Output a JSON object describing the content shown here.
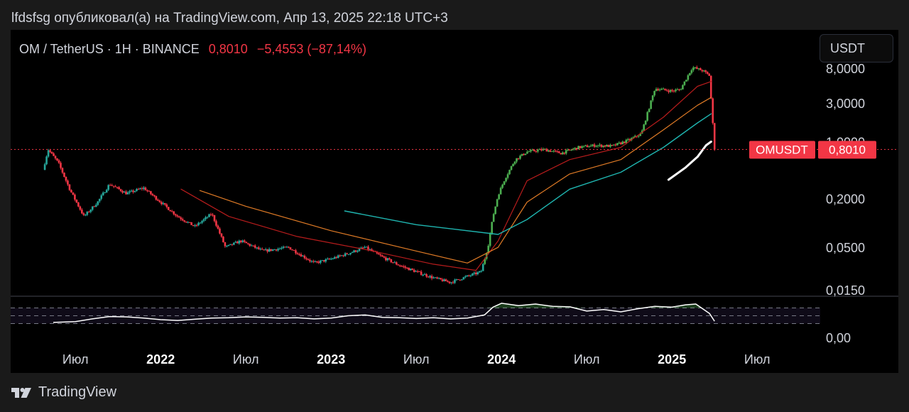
{
  "caption": "lfdsfsg опубликовал(а) на TradingView.com, Апр 13, 2025 22:18 UTC+3",
  "legend": {
    "symbol": "OM / TetherUS · 1H · BINANCE",
    "last": "0,8010",
    "change": "−5,4553 (−87,14%)"
  },
  "currency_button": "USDT",
  "colors": {
    "up": "#26a69a",
    "up_bright": "#4caf50",
    "down": "#f23645",
    "ma_red": "#b71c1c",
    "ma_orange": "#e07b26",
    "ma_cyan": "#1fb5b0",
    "rsi": "#ffffff"
  },
  "chart_data": {
    "type": "line",
    "title": "",
    "price_scale": "log",
    "y_ticks": [
      "8,0000",
      "3,0000",
      "1,0000",
      "0,2000",
      "0,0500",
      "0,0150"
    ],
    "y_tick_values": [
      8,
      3,
      1,
      0.2,
      0.05,
      0.015
    ],
    "ylim": [
      0.0125,
      13
    ],
    "rsi_tick": "0,00",
    "x_ticks": [
      "Июл",
      "2022",
      "Июл",
      "2023",
      "Июл",
      "2024",
      "Июл",
      "2025",
      "Июл"
    ],
    "x_tick_years": [
      2021.5,
      2022.0,
      2022.5,
      2023.0,
      2023.5,
      2024.0,
      2024.5,
      2025.0,
      2025.5
    ],
    "xlim": [
      2021.12,
      2025.87
    ],
    "last_price_label": "OMUSDT",
    "last_price_value": "0,8010",
    "last_price": 0.801,
    "series": [
      {
        "points": [
          [
            2021.31,
            0.45
          ],
          [
            2021.34,
            0.8
          ],
          [
            2021.4,
            0.55
          ],
          [
            2021.47,
            0.25
          ],
          [
            2021.55,
            0.12
          ],
          [
            2021.63,
            0.18
          ],
          [
            2021.7,
            0.3
          ],
          [
            2021.8,
            0.23
          ],
          [
            2021.9,
            0.27
          ],
          [
            2022.0,
            0.18
          ],
          [
            2022.1,
            0.12
          ],
          [
            2022.2,
            0.09
          ],
          [
            2022.3,
            0.13
          ],
          [
            2022.38,
            0.05
          ],
          [
            2022.47,
            0.06
          ],
          [
            2022.6,
            0.045
          ],
          [
            2022.75,
            0.05
          ],
          [
            2022.9,
            0.032
          ],
          [
            2023.0,
            0.036
          ],
          [
            2023.1,
            0.042
          ],
          [
            2023.2,
            0.05
          ],
          [
            2023.3,
            0.038
          ],
          [
            2023.4,
            0.03
          ],
          [
            2023.5,
            0.025
          ],
          [
            2023.6,
            0.021
          ],
          [
            2023.7,
            0.0185
          ],
          [
            2023.8,
            0.022
          ],
          [
            2023.88,
            0.025
          ],
          [
            2023.92,
            0.05
          ],
          [
            2023.95,
            0.12
          ],
          [
            2023.98,
            0.22
          ],
          [
            2024.02,
            0.35
          ],
          [
            2024.08,
            0.6
          ],
          [
            2024.15,
            0.75
          ],
          [
            2024.25,
            0.8
          ],
          [
            2024.35,
            0.72
          ],
          [
            2024.45,
            0.85
          ],
          [
            2024.55,
            0.9
          ],
          [
            2024.65,
            0.88
          ],
          [
            2024.75,
            1.05
          ],
          [
            2024.82,
            1.25
          ],
          [
            2024.9,
            4.5
          ],
          [
            2025.0,
            4.2
          ],
          [
            2025.05,
            4.4
          ],
          [
            2025.12,
            8.2
          ],
          [
            2025.18,
            7.5
          ],
          [
            2025.22,
            6.5
          ],
          [
            2025.25,
            0.801
          ]
        ]
      },
      {
        "points": [
          [
            2022.12,
            0.26
          ],
          [
            2022.4,
            0.12
          ],
          [
            2022.8,
            0.068
          ],
          [
            2023.2,
            0.047
          ],
          [
            2023.6,
            0.031
          ],
          [
            2023.85,
            0.026
          ],
          [
            2023.98,
            0.06
          ],
          [
            2024.15,
            0.33
          ],
          [
            2024.4,
            0.6
          ],
          [
            2024.7,
            0.85
          ],
          [
            2024.95,
            2.0
          ],
          [
            2025.15,
            4.8
          ],
          [
            2025.23,
            5.5
          ]
        ]
      },
      {
        "points": [
          [
            2022.23,
            0.25
          ],
          [
            2022.5,
            0.16
          ],
          [
            2023.0,
            0.08
          ],
          [
            2023.5,
            0.045
          ],
          [
            2023.8,
            0.032
          ],
          [
            2023.98,
            0.05
          ],
          [
            2024.15,
            0.18
          ],
          [
            2024.4,
            0.4
          ],
          [
            2024.7,
            0.6
          ],
          [
            2024.95,
            1.4
          ],
          [
            2025.15,
            2.8
          ],
          [
            2025.23,
            3.5
          ]
        ]
      },
      {
        "points": [
          [
            2023.08,
            0.14
          ],
          [
            2023.5,
            0.095
          ],
          [
            2023.98,
            0.072
          ],
          [
            2024.15,
            0.11
          ],
          [
            2024.4,
            0.26
          ],
          [
            2024.7,
            0.42
          ],
          [
            2024.95,
            0.85
          ],
          [
            2025.15,
            1.7
          ],
          [
            2025.23,
            2.2
          ]
        ]
      },
      {
        "points": [
          [
            2024.98,
            0.34
          ],
          [
            2025.08,
            0.48
          ],
          [
            2025.15,
            0.65
          ],
          [
            2025.2,
            0.9
          ],
          [
            2025.23,
            1.0
          ]
        ]
      }
    ],
    "rsi": {
      "points": [
        [
          2021.37,
          33
        ],
        [
          2021.5,
          35
        ],
        [
          2021.6,
          42
        ],
        [
          2021.7,
          48
        ],
        [
          2021.8,
          47
        ],
        [
          2021.9,
          44
        ],
        [
          2022.0,
          40
        ],
        [
          2022.1,
          38
        ],
        [
          2022.2,
          41
        ],
        [
          2022.3,
          44
        ],
        [
          2022.4,
          45
        ],
        [
          2022.5,
          47
        ],
        [
          2022.6,
          46
        ],
        [
          2022.7,
          44
        ],
        [
          2022.8,
          45
        ],
        [
          2022.9,
          42
        ],
        [
          2023.0,
          44
        ],
        [
          2023.1,
          50
        ],
        [
          2023.2,
          52
        ],
        [
          2023.3,
          46
        ],
        [
          2023.4,
          45
        ],
        [
          2023.5,
          43
        ],
        [
          2023.6,
          45
        ],
        [
          2023.7,
          42
        ],
        [
          2023.8,
          44
        ],
        [
          2023.9,
          52
        ],
        [
          2023.95,
          72
        ],
        [
          2024.0,
          82
        ],
        [
          2024.1,
          76
        ],
        [
          2024.2,
          80
        ],
        [
          2024.3,
          74
        ],
        [
          2024.4,
          73
        ],
        [
          2024.5,
          62
        ],
        [
          2024.6,
          66
        ],
        [
          2024.7,
          60
        ],
        [
          2024.8,
          68
        ],
        [
          2024.9,
          74
        ],
        [
          2025.0,
          72
        ],
        [
          2025.08,
          78
        ],
        [
          2025.14,
          80
        ],
        [
          2025.18,
          68
        ],
        [
          2025.22,
          56
        ],
        [
          2025.25,
          36
        ]
      ]
    }
  }
}
